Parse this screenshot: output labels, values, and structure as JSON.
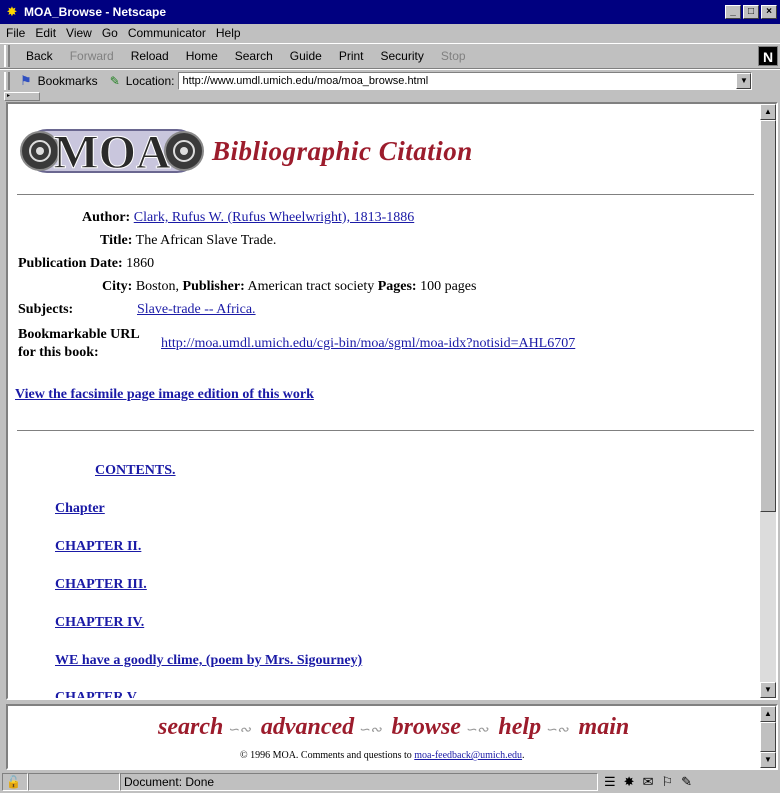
{
  "window": {
    "title": "MOA_Browse - Netscape"
  },
  "menu": [
    "File",
    "Edit",
    "View",
    "Go",
    "Communicator",
    "Help"
  ],
  "nav_buttons": [
    {
      "label": "Back",
      "enabled": true
    },
    {
      "label": "Forward",
      "enabled": false
    },
    {
      "label": "Reload",
      "enabled": true
    },
    {
      "label": "Home",
      "enabled": true
    },
    {
      "label": "Search",
      "enabled": true
    },
    {
      "label": "Guide",
      "enabled": true
    },
    {
      "label": "Print",
      "enabled": true
    },
    {
      "label": "Security",
      "enabled": true
    },
    {
      "label": "Stop",
      "enabled": false
    }
  ],
  "location_bar": {
    "bookmarks_label": "Bookmarks",
    "location_label": "Location:",
    "url": "http://www.umdl.umich.edu/moa/moa_browse.html"
  },
  "page": {
    "logo_text": "MOA",
    "heading": "Bibliographic Citation",
    "author_label": "Author:",
    "author": "Clark, Rufus W. (Rufus Wheelwright), 1813-1886",
    "title_label": "Title:",
    "title": "The African Slave Trade.",
    "pubdate_label": "Publication Date:",
    "pubdate": "1860",
    "city_label": "City:",
    "city": "Boston,",
    "publisher_label": "Publisher:",
    "publisher": "American tract society",
    "pages_label": "Pages:",
    "pages": "100 pages",
    "subjects_label": "Subjects:",
    "subjects": "Slave-trade -- Africa.",
    "bookmark_label_1": "Bookmarkable URL",
    "bookmark_label_2": "for this book:",
    "bookmark_url": "http://moa.umdl.umich.edu/cgi-bin/moa/sgml/moa-idx?notisid=AHL6707",
    "facsimile_link": "View the facsimile page image edition of this work",
    "contents_heading": "CONTENTS.",
    "toc": [
      "Chapter",
      "CHAPTER II.",
      "CHAPTER III.",
      "CHAPTER IV.",
      "WE have a goodly clime, (poem by Mrs. Sigourney)",
      "CHAPTER V."
    ]
  },
  "footer": {
    "links": [
      "search",
      "advanced",
      "browse",
      "help",
      "main"
    ],
    "copyright": "© 1996 MOA. Comments and questions to",
    "email": "moa-feedback@umich.edu",
    "email_tail": "."
  },
  "status": {
    "text": "Document: Done"
  },
  "colors": {
    "titlebar": "#000080",
    "link": "#1a1aa6",
    "brand_red": "#9c1c2c"
  }
}
